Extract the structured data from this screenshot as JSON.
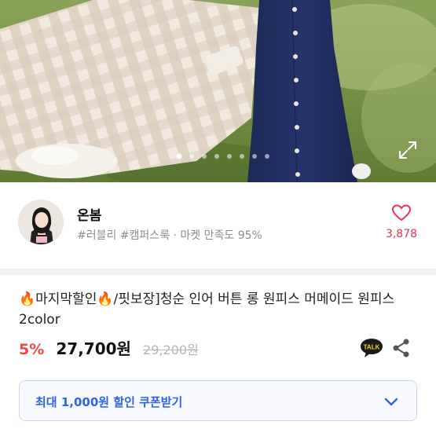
{
  "product": {
    "title": "🔥마지막할인🔥/핏보장]청순 인어 버튼 롱 원피스 머메이드 원피스 2color",
    "discount_rate": "5%",
    "price": "27,700원",
    "original_price": "29,200원"
  },
  "seller": {
    "name": "온봄",
    "tags": "#러블리 #캠퍼스룩 · 마켓 만족도 95%",
    "like_count": "3,878"
  },
  "gallery": {
    "dot_count": 8,
    "active_index": 0
  },
  "coupon": {
    "label": "최대 1,000원 할인 쿠폰받기"
  },
  "actions": {
    "talk_label": "TALK"
  },
  "colors": {
    "accent_red": "#e8344e",
    "discount_red": "#f24747",
    "coupon_blue": "#2f63e6",
    "talk_yellow": "#1a1a1a"
  }
}
